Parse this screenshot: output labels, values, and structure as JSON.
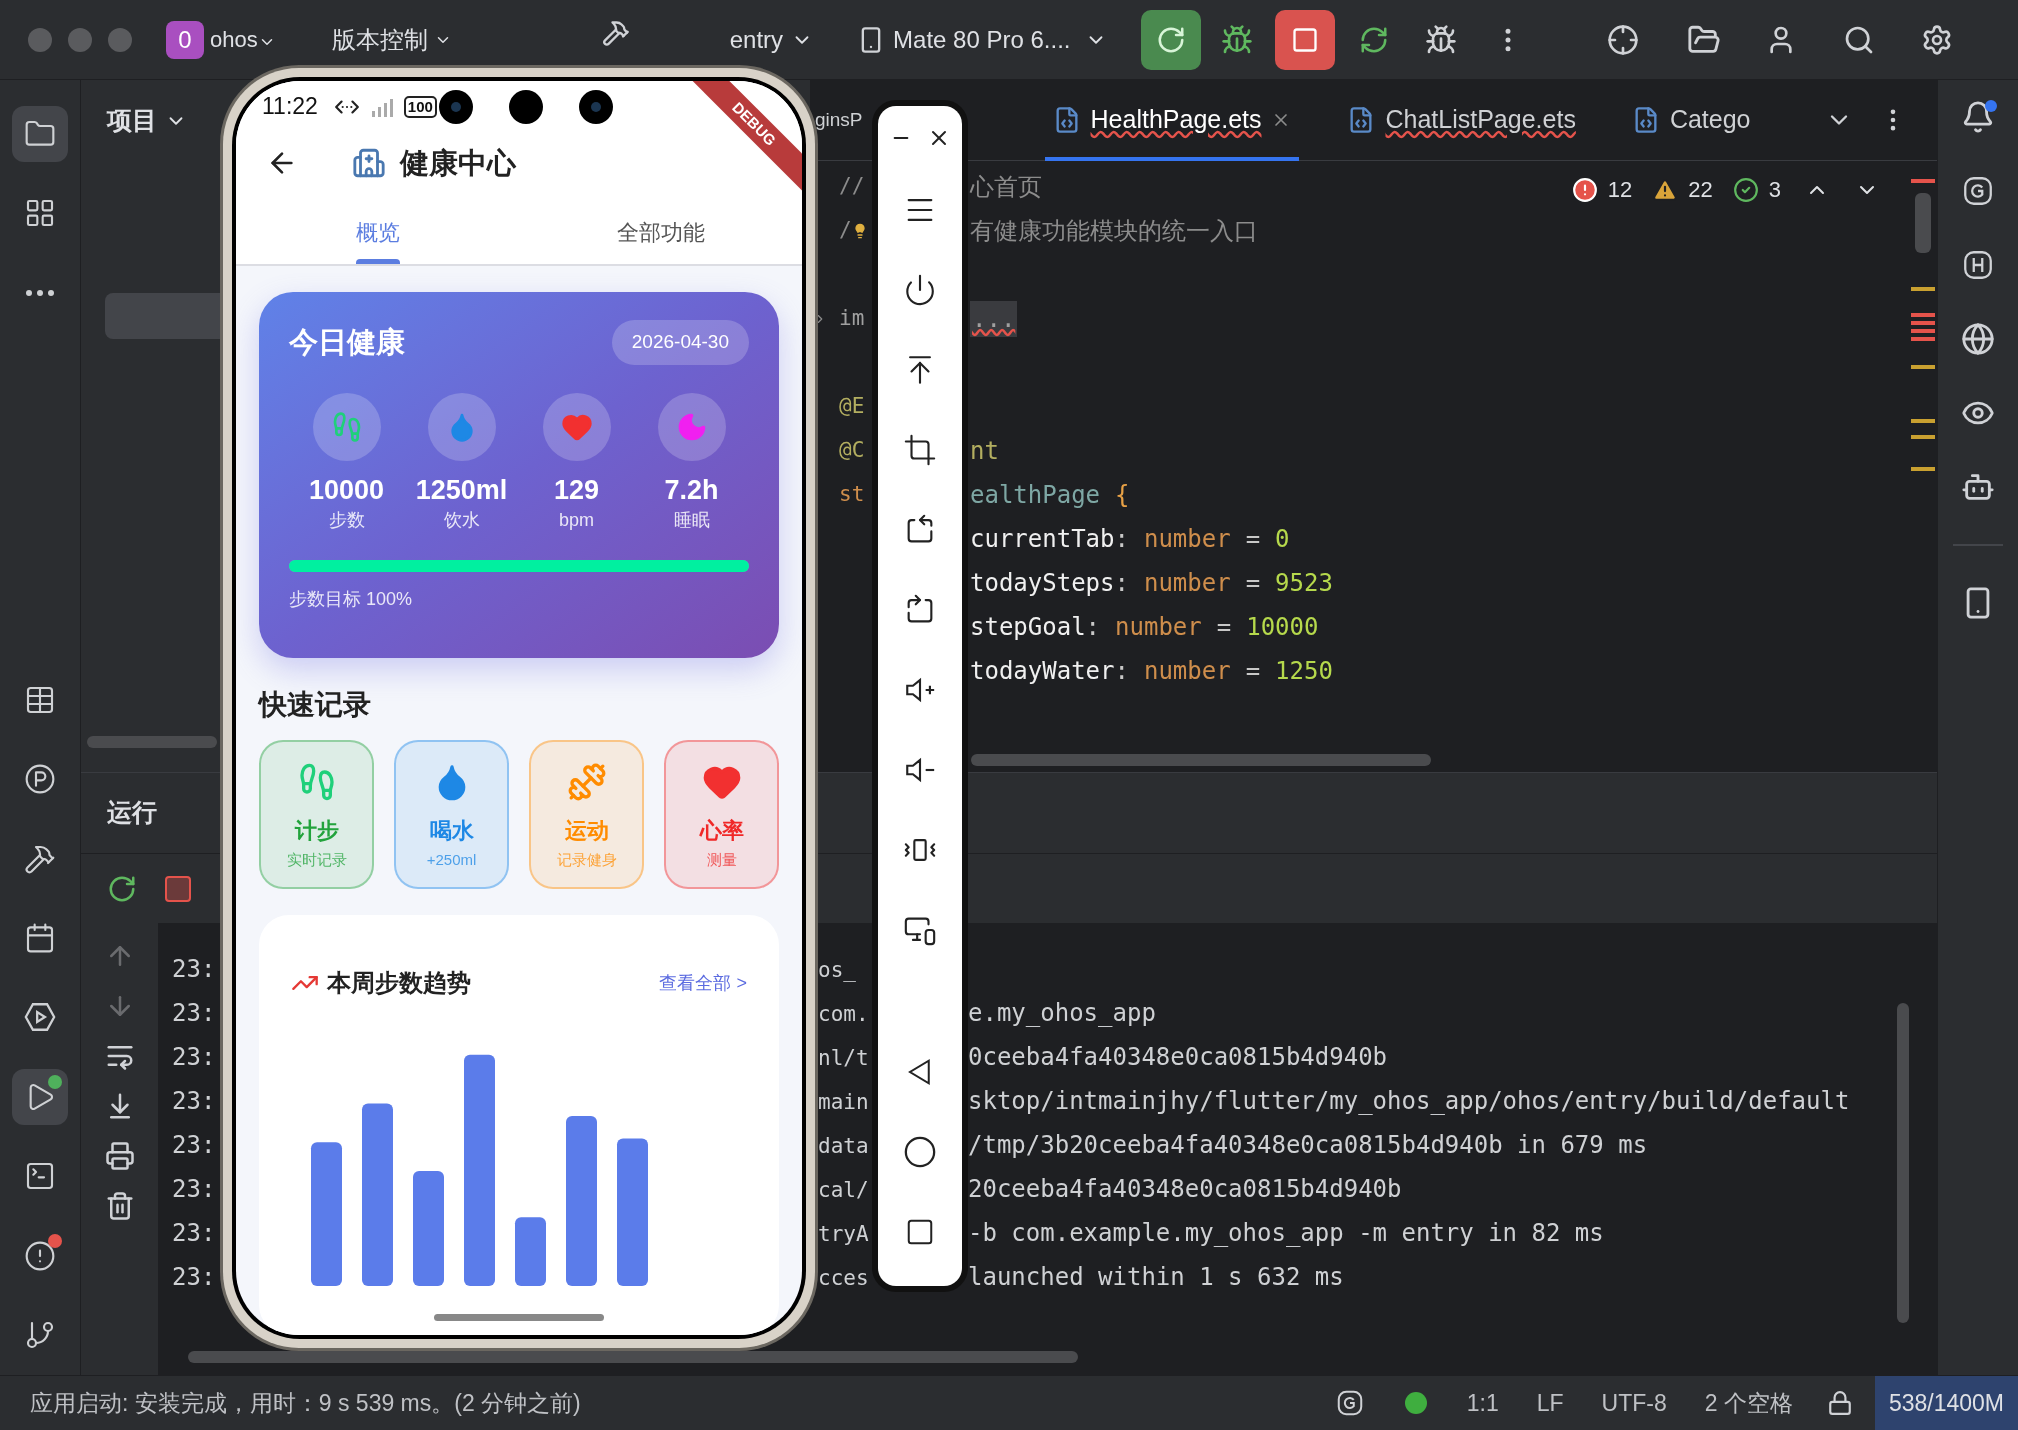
{
  "title_bar": {
    "project_badge": "0",
    "project": "ohos",
    "vcs": "版本控制",
    "run_config": "entry",
    "device": "Mate 80 Pro 6...."
  },
  "activity_bar": {
    "top": [
      {
        "kind": "project",
        "selected": true
      },
      {
        "kind": "structure",
        "selected": false
      },
      {
        "kind": "more",
        "selected": false
      }
    ],
    "bottom": [
      {
        "kind": "table",
        "selected": false
      },
      {
        "kind": "p",
        "selected": false
      },
      {
        "kind": "build",
        "selected": false
      },
      {
        "kind": "todo",
        "selected": false
      },
      {
        "kind": "services",
        "selected": false
      },
      {
        "kind": "run",
        "selected": true,
        "color": "#4fb05c"
      },
      {
        "kind": "terminal",
        "selected": false
      },
      {
        "kind": "problems",
        "selected": false,
        "color": "#e5534b"
      },
      {
        "kind": "git",
        "selected": false
      }
    ]
  },
  "project_panel": {
    "title": "项目"
  },
  "editor": {
    "tabs": [
      {
        "label": "ginsP",
        "selected": false,
        "errors": false,
        "icon": false
      },
      {
        "label": "HealthPage.ets",
        "selected": true,
        "errors": true,
        "icon": true
      },
      {
        "label": "ChatListPage.ets",
        "selected": false,
        "errors": true,
        "icon": true
      },
      {
        "label": "Catego",
        "selected": false,
        "errors": false,
        "icon": true
      }
    ],
    "inspections": {
      "errors": "12",
      "warnings": "22",
      "ok": "3"
    },
    "lines": [
      {
        "kind": "comment",
        "left": "//",
        "text": "心首页"
      },
      {
        "kind": "comment",
        "left": "/",
        "bulb": true,
        "text": "有健康功能模块的统一入口"
      },
      {
        "kind": "blank"
      },
      {
        "kind": "folded",
        "left": "im",
        "text": "..."
      },
      {
        "kind": "blank"
      },
      {
        "kind": "decorator",
        "left": "@E"
      },
      {
        "kind": "decorator",
        "left": "@C",
        "text": "nt"
      },
      {
        "kind": "struct",
        "left": "st",
        "tokens": [
          {
            "kind": "struct",
            "text": "ealthPage"
          },
          {
            "kind": "brace",
            "text": "{"
          }
        ]
      },
      {
        "kind": "field",
        "tokens": [
          {
            "kind": "name",
            "text": "currentTab"
          },
          {
            "kind": "punct",
            "text": ":"
          },
          {
            "kind": "type",
            "text": "number"
          },
          {
            "kind": "op",
            "text": "="
          },
          {
            "kind": "num",
            "text": "0"
          }
        ]
      },
      {
        "kind": "field",
        "tokens": [
          {
            "kind": "name",
            "text": "todaySteps"
          },
          {
            "kind": "punct",
            "text": ":"
          },
          {
            "kind": "type",
            "text": "number"
          },
          {
            "kind": "op",
            "text": "="
          },
          {
            "kind": "num",
            "text": "9523"
          }
        ]
      },
      {
        "kind": "field",
        "tokens": [
          {
            "kind": "name",
            "text": "stepGoal"
          },
          {
            "kind": "punct",
            "text": ":"
          },
          {
            "kind": "type",
            "text": "number"
          },
          {
            "kind": "op",
            "text": "="
          },
          {
            "kind": "num",
            "text": "10000"
          }
        ]
      },
      {
        "kind": "field",
        "tokens": [
          {
            "kind": "name",
            "text": "todayWater"
          },
          {
            "kind": "punct",
            "text": ":"
          },
          {
            "kind": "type",
            "text": "number"
          },
          {
            "kind": "op",
            "text": "="
          },
          {
            "kind": "num",
            "text": "1250"
          }
        ]
      }
    ]
  },
  "run_panel": {
    "title": "运行",
    "lines": [
      {
        "time": "23:",
        "left": "os_"
      },
      {
        "time": "23:",
        "left": "com.",
        "text": "e.my_ohos_app"
      },
      {
        "time": "23:",
        "left": "nl/t",
        "text": "0ceeba4fa40348e0ca0815b4d940b"
      },
      {
        "time": "23:",
        "left": "main",
        "text": "sktop/intmainjhy/flutter/my_ohos_app/ohos/entry/build/default"
      },
      {
        "time": "23:",
        "left": "data",
        "text": "/tmp/3b20ceeba4fa40348e0ca0815b4d940b in 679 ms"
      },
      {
        "time": "23:",
        "left": "cal/",
        "text": "20ceeba4fa40348e0ca0815b4d940b"
      },
      {
        "time": "23:",
        "left": "tryA",
        "text": "-b com.example.my_ohos_app -m entry in 82 ms"
      },
      {
        "time": "23:",
        "left": "cces",
        "text": "launched within 1 s 632 ms"
      }
    ]
  },
  "phone": {
    "time": "11:22",
    "battery": "100",
    "debug": "DEBUG",
    "title": "健康中心",
    "tabs": [
      {
        "label": "概览",
        "selected": true
      },
      {
        "label": "全部功能",
        "selected": false
      }
    ],
    "card": {
      "title": "今日健康",
      "date": "2026-04-30",
      "stats": [
        {
          "kind": "steps",
          "value": "10000",
          "label": "步数"
        },
        {
          "kind": "water",
          "value": "1250ml",
          "label": "饮水"
        },
        {
          "kind": "heart",
          "value": "129",
          "label": "bpm"
        },
        {
          "kind": "sleep",
          "value": "7.2h",
          "label": "睡眠"
        }
      ],
      "progress": {
        "level": 1,
        "label": "步数目标 100%"
      }
    },
    "quick": {
      "title": "快速记录",
      "items": [
        {
          "kind": "steps",
          "title": "计步",
          "subtitle": "实时记录",
          "color": "#22a33c"
        },
        {
          "kind": "water",
          "title": "喝水",
          "subtitle": "+250ml",
          "color": "#1e88e5"
        },
        {
          "kind": "exercise",
          "title": "运动",
          "subtitle": "记录健身",
          "color": "#ff8c00"
        },
        {
          "kind": "heart",
          "title": "心率",
          "subtitle": "测量",
          "color": "#f02828"
        }
      ]
    },
    "trend": {
      "title": "本周步数趋势",
      "link": "查看全部 >"
    }
  },
  "status_bar": {
    "message": "应用启动: 安装完成，用时：9 s 539 ms。(2 分钟之前)",
    "position": "1:1",
    "line_separator": "LF",
    "encoding": "UTF-8",
    "indent": "2 个空格",
    "memory": "538/1400M"
  }
}
